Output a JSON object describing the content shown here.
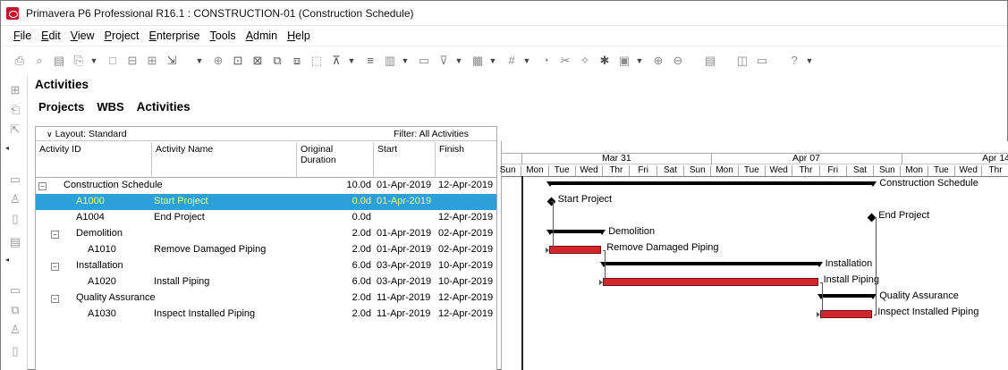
{
  "window": {
    "title": "Primavera P6 Professional R16.1 : CONSTRUCTION-01 (Construction Schedule)"
  },
  "menu": [
    {
      "label": "File",
      "accel": "F",
      "rest": "ile"
    },
    {
      "label": "Edit",
      "accel": "E",
      "rest": "dit"
    },
    {
      "label": "View",
      "accel": "V",
      "rest": "iew"
    },
    {
      "label": "Project",
      "accel": "P",
      "rest": "roject"
    },
    {
      "label": "Enterprise",
      "accel": "E",
      "rest": "nterprise"
    },
    {
      "label": "Tools",
      "accel": "T",
      "rest": "ools"
    },
    {
      "label": "Admin",
      "accel": "A",
      "rest": "dmin"
    },
    {
      "label": "Help",
      "accel": "H",
      "rest": "elp"
    }
  ],
  "toolbar_icons": [
    "print-icon",
    "print-preview-icon",
    "page-setup-icon",
    "publish-icon",
    "undo-icon",
    "cut-icon",
    "copy-icon",
    "paste-icon",
    "add-icon",
    "delete-icon",
    "dissolve-icon",
    "assign-icon",
    "link-icon",
    "unlink-icon",
    "layout-icon",
    "bars-icon",
    "columns-icon",
    "filter-icon",
    "group-icon",
    "sort-icon",
    "schedule-icon",
    "level-icon",
    "progress-icon",
    "store-period-icon",
    "apply-actuals-icon",
    "zoom-in-icon",
    "zoom-out-icon",
    "split-icon",
    "window-icon",
    "comment-icon",
    "help-icon"
  ],
  "panel": {
    "title": "Activities",
    "tabs": [
      "Projects",
      "WBS",
      "Activities"
    ]
  },
  "grid": {
    "layout_label": "Layout: Standard",
    "filter_label": "Filter: All Activities",
    "columns": [
      "Activity ID",
      "Activity Name",
      "Original Duration",
      "Start",
      "Finish"
    ],
    "rows": [
      {
        "id": "Construction Schedule",
        "name": "",
        "duration": "10.0d",
        "start": "01-Apr-2019",
        "finish": "12-Apr-2019",
        "level": 0,
        "group": true,
        "selected": false
      },
      {
        "id": "A1000",
        "name": "Start Project",
        "duration": "0.0d",
        "start": "01-Apr-2019",
        "finish": "",
        "level": 1,
        "group": false,
        "selected": true
      },
      {
        "id": "A1004",
        "name": "End Project",
        "duration": "0.0d",
        "start": "",
        "finish": "12-Apr-2019",
        "level": 1,
        "group": false,
        "selected": false
      },
      {
        "id": "Demolition",
        "name": "",
        "duration": "2.0d",
        "start": "01-Apr-2019",
        "finish": "02-Apr-2019",
        "level": 1,
        "group": true,
        "selected": false
      },
      {
        "id": "A1010",
        "name": "Remove Damaged Piping",
        "duration": "2.0d",
        "start": "01-Apr-2019",
        "finish": "02-Apr-2019",
        "level": 2,
        "group": false,
        "selected": false
      },
      {
        "id": "Installation",
        "name": "",
        "duration": "6.0d",
        "start": "03-Apr-2019",
        "finish": "10-Apr-2019",
        "level": 1,
        "group": true,
        "selected": false
      },
      {
        "id": "A1020",
        "name": "Install Piping",
        "duration": "6.0d",
        "start": "03-Apr-2019",
        "finish": "10-Apr-2019",
        "level": 2,
        "group": false,
        "selected": false
      },
      {
        "id": "Quality Assurance",
        "name": "",
        "duration": "2.0d",
        "start": "11-Apr-2019",
        "finish": "12-Apr-2019",
        "level": 1,
        "group": true,
        "selected": false
      },
      {
        "id": "A1030",
        "name": "Inspect Installed Piping",
        "duration": "2.0d",
        "start": "11-Apr-2019",
        "finish": "12-Apr-2019",
        "level": 2,
        "group": false,
        "selected": false
      }
    ]
  },
  "gantt": {
    "weeks": [
      "Mar 31",
      "Apr 07",
      "Apr 14"
    ],
    "days": [
      "Sun",
      "Mon",
      "Tue",
      "Wed",
      "Thr",
      "Fri",
      "Sat",
      "Sun",
      "Mon",
      "Tue",
      "Wed",
      "Thr",
      "Fri",
      "Sat",
      "Sun",
      "Mon",
      "Tue",
      "Wed",
      "Thr"
    ],
    "first_day_date": "2019-03-30",
    "bars": [
      {
        "label": "Construction Schedule",
        "kind": "summary",
        "start": "2019-04-01",
        "finish": "2019-04-12"
      },
      {
        "label": "Start Project",
        "kind": "milestone",
        "start": "2019-04-01",
        "finish": "2019-04-01"
      },
      {
        "label": "End Project",
        "kind": "milestone-end",
        "start": "2019-04-12",
        "finish": "2019-04-12"
      },
      {
        "label": "Demolition",
        "kind": "summary",
        "start": "2019-04-01",
        "finish": "2019-04-02"
      },
      {
        "label": "Remove Damaged Piping",
        "kind": "task",
        "start": "2019-04-01",
        "finish": "2019-04-02"
      },
      {
        "label": "Installation",
        "kind": "summary",
        "start": "2019-04-03",
        "finish": "2019-04-10"
      },
      {
        "label": "Install Piping",
        "kind": "task",
        "start": "2019-04-03",
        "finish": "2019-04-10"
      },
      {
        "label": "Quality Assurance",
        "kind": "summary",
        "start": "2019-04-11",
        "finish": "2019-04-12"
      },
      {
        "label": "Inspect Installed Piping",
        "kind": "task",
        "start": "2019-04-11",
        "finish": "2019-04-12"
      }
    ],
    "colors": {
      "task": "#d1262c",
      "summary": "#000000",
      "selection": "#2d9fd9"
    }
  }
}
